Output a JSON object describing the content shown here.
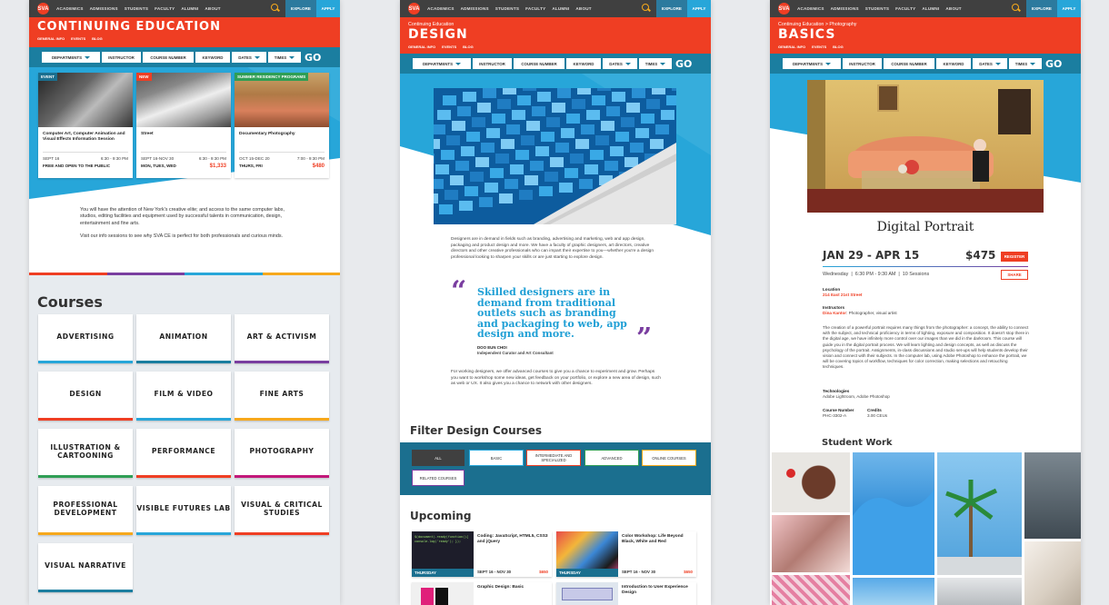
{
  "nav": {
    "items": [
      "ACADEMICS",
      "ADMISSIONS",
      "STUDENTS",
      "FACULTY",
      "ALUMNI",
      "ABOUT"
    ],
    "explore": "EXPLORE",
    "apply": "APPLY",
    "logo": "SVA"
  },
  "subnav": [
    "GENERAL INFO",
    "EVENTS",
    "BLOG"
  ],
  "filters": {
    "departments": "DEPARTMENTS",
    "instructor": "INSTRUCTOR",
    "course_number": "COURSE NUMBER",
    "keyword": "KEYWORD",
    "dates": "DATES",
    "times": "TIMES",
    "go": "GO"
  },
  "page1": {
    "title": "CONTINUING EDUCATION",
    "cards": [
      {
        "tag": "EVENT",
        "name": "Computer Art, Computer Animation and Visual Effects Information Session",
        "date": "SEPT 16",
        "time": "6:30 - 9:30 PM",
        "days": "FREE AND OPEN TO THE PUBLIC",
        "price": ""
      },
      {
        "tag": "NEW",
        "name": "Street",
        "date": "SEPT 16-NOV 30",
        "time": "6:30 - 9:30 PM",
        "days": "MON, TUES, WED",
        "price": "$1,333"
      },
      {
        "tag": "SUMMER RESIDENCY PROGRAMS",
        "name": "Documentary Photography",
        "date": "OCT 15-DEC 20",
        "time": "7:00 - 9:30 PM",
        "days": "THURS, FRI",
        "price": "$480"
      }
    ],
    "intro1": "You will have the attention of New York's creative elite; and access to the same computer labs, studios, editing facilities and equipment used by successful talents in communication, design, entertainment and fine arts.",
    "intro2": "Visit our info sessions to see why SVA CE is perfect for both professionals and curious minds.",
    "courses_heading": "Courses",
    "courses": [
      "ADVERTISING",
      "ANIMATION",
      "ART & ACTIVISM",
      "DESIGN",
      "FILM & VIDEO",
      "FINE ARTS",
      "ILLUSTRATION & CARTOONING",
      "PERFORMANCE",
      "PHOTOGRAPHY",
      "PROFESSIONAL DEVELOPMENT",
      "VISIBLE FUTURES LAB",
      "VISUAL & CRITICAL STUDIES",
      "VISUAL NARRATIVE"
    ]
  },
  "page2": {
    "crumb": "Continuing Education",
    "title": "DESIGN",
    "body1": "Designers are in demand in fields such as branding, advertising and marketing, web and app design, packaging and product design and more. We have a faculty of graphic designers, art directors, creative directors and other creative professionals who can impart their expertise to you—whether you're a design professional looking to sharpen your skills or are just starting to explore design.",
    "quote": "Skilled designers are in demand from traditional outlets such as branding and packaging to web, app design and more.",
    "quote_name": "DOO EUN CHOI",
    "quote_role": "Independent Curator and Art Consultant",
    "body2": "For working designers, we offer advanced courses to give you a chance to experiment and grow. Perhaps you want to workshop some new ideas, get feedback on your portfolio, or explore a new area of design, such as web or UX. It also gives you a chance to network with other designers.",
    "filter_heading": "Filter Design Courses",
    "filter_buttons": [
      "ALL",
      "BASIC",
      "INTERMEDIATE AND SPECIALIZED",
      "ADVANCED",
      "ONLINE COURSES",
      "RELATED COURSES"
    ],
    "upcoming_heading": "Upcoming",
    "upcoming": [
      {
        "name": "Coding: JavaScript, HTML5, CSS3 and jQuery",
        "day": "THURSDAY",
        "dates": "SEPT 16 - NOV 30",
        "price": "$650",
        "code": "$(document).ready(function(){ console.log('ready'); });"
      },
      {
        "name": "Color Workshop: Life Beyond Black, White and Red",
        "day": "THURSDAY",
        "dates": "SEPT 16 - NOV 30",
        "price": "$650"
      },
      {
        "name": "Graphic Design: Basic",
        "day": "",
        "dates": "",
        "price": ""
      },
      {
        "name": "Introduction to User Experience Design",
        "day": "",
        "dates": "",
        "price": ""
      }
    ]
  },
  "page3": {
    "crumb": "Continuing Education > Photography",
    "title": "BASICS",
    "course_title": "Digital Portrait",
    "dates": "JAN 29 - APR 15",
    "price": "$475",
    "register": "REGISTER",
    "share": "SHARE",
    "schedule": "Wednesday  |  6:30 PM - 9:30 AM  |  10 Sessions",
    "location_label": "Location",
    "location": "214 East 21st Street",
    "instructors_label": "Instructors",
    "instructor_name": "Dina Kantor",
    "instructor_role": ": Photographer, visual artist",
    "description": "The creation of a powerful portrait requires many things from the photographer: a concept, the ability to connect with the subject, and technical proficiency in terms of lighting, exposure and composition. It doesn't stop there in the digital age, we have infinitely more control over our images than we did in the darkroom. This course will guide you in the digital portrait process. We will learn lighting and design concepts, as well as discuss the psychology of the portrait. Assignments, in-class discussions and studio set-ups will help students develop their vision and connect with their subjects. In the computer lab, using Adobe Photoshop to enhance the portrait, we will be covering topics of workflow, techniques for color correction, making selections and retouching techniques.",
    "tech_label": "Technologies",
    "tech": "Adobe Lightroom, Adobe Photoshop",
    "course_number_label": "Course Number",
    "course_number": "PHC-3302-A",
    "credits_label": "Credits",
    "credits": "3.00 CEUs",
    "student_work": "Student Work"
  },
  "colors": {
    "red": "#ef3e23",
    "teal": "#1b7ea0",
    "blue": "#27a6d9",
    "dark": "#404040"
  }
}
